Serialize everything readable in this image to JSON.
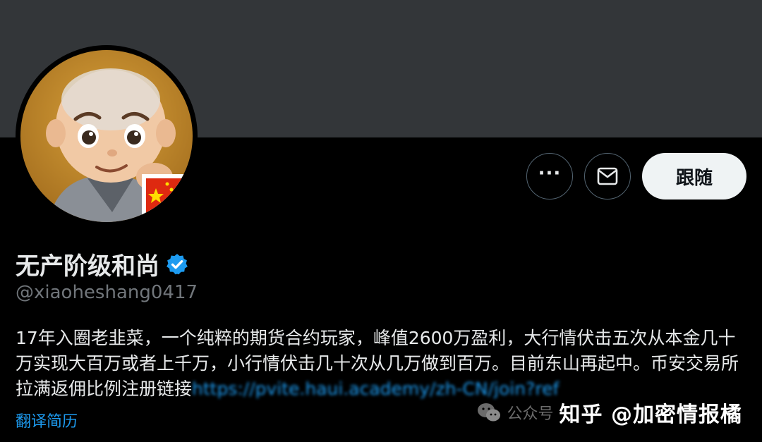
{
  "profile": {
    "display_name": "无产阶级和尚",
    "handle": "@xiaoheshang0417",
    "bio_text": "17年入圈老韭菜，一个纯粹的期货合约玩家，峰值2600万盈利，大行情伏击五次从本金几十万实现大百万或者上千万，小行情伏击几十次从几万做到百万。目前东山再起中。币安交易所拉满返佣比例注册链接",
    "bio_link": "https://pvite.haui.academy/zh-CN/join?ref",
    "translate_label": "翻译简历",
    "avatar_icon": "cartoon-monk-avatar",
    "verified_icon": "verified-badge-icon"
  },
  "actions": {
    "more_label": "···",
    "more_icon": "more-dots-icon",
    "message_icon": "mail-icon",
    "follow_label": "跟随"
  },
  "watermark": {
    "faint_text": "公众号",
    "main_text": "知乎 @加密情报橘",
    "logo_icon": "wechat-icon"
  },
  "colors": {
    "background": "#000000",
    "banner": "#333639",
    "accent": "#1d9bf0",
    "muted": "#71767b",
    "follow_bg": "#eff3f4"
  }
}
